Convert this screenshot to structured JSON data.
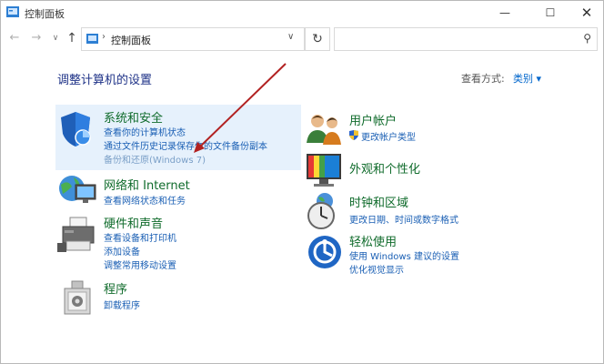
{
  "window": {
    "title": "控制面板"
  },
  "nav": {
    "address": "控制面板",
    "address_sep": "›"
  },
  "main": {
    "heading": "调整计算机的设置",
    "view_by_label": "查看方式:",
    "view_by_value": "类别 ▾"
  },
  "categories": {
    "system": {
      "title": "系统和安全",
      "links": [
        "查看你的计算机状态",
        "通过文件历史记录保存你的文件备份副本",
        "备份和还原(Windows 7)"
      ]
    },
    "network": {
      "title": "网络和 Internet",
      "links": [
        "查看网络状态和任务"
      ]
    },
    "hardware": {
      "title": "硬件和声音",
      "links": [
        "查看设备和打印机",
        "添加设备",
        "调整常用移动设置"
      ]
    },
    "programs": {
      "title": "程序",
      "links": [
        "卸载程序"
      ]
    },
    "accounts": {
      "title": "用户帐户",
      "links": [
        "更改帐户类型"
      ]
    },
    "appearance": {
      "title": "外观和个性化",
      "links": []
    },
    "clock": {
      "title": "时钟和区域",
      "links": [
        "更改日期、时间或数字格式"
      ]
    },
    "ease": {
      "title": "轻松使用",
      "links": [
        "使用 Windows 建议的设置",
        "优化视觉显示"
      ]
    }
  },
  "colors": {
    "title_green": "#0f6b2b",
    "link_blue": "#1a5fb4",
    "heading_blue": "#1e3287",
    "highlight": "#e6f1fc",
    "annotation_arrow": "#b22222"
  }
}
